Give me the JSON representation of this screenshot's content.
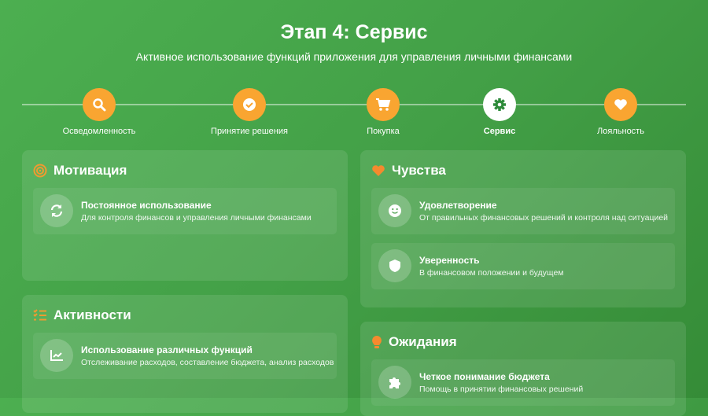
{
  "header": {
    "title": "Этап 4: Сервис",
    "subtitle": "Активное использование функций приложения для управления личными финансами"
  },
  "steps": [
    {
      "label": "Осведомленность",
      "icon": "search-icon"
    },
    {
      "label": "Принятие решения",
      "icon": "check-circle-icon"
    },
    {
      "label": "Покупка",
      "icon": "cart-icon"
    },
    {
      "label": "Сервис",
      "icon": "gear-icon",
      "active": true
    },
    {
      "label": "Лояльность",
      "icon": "heart-icon"
    }
  ],
  "cards": {
    "motivation": {
      "title": "Мотивация",
      "icon": "target-icon",
      "items": [
        {
          "title": "Постоянное использование",
          "desc": "Для контроля финансов и управления личными финансами",
          "icon": "sync-icon"
        }
      ]
    },
    "activities": {
      "title": "Активности",
      "icon": "task-list-icon",
      "items": [
        {
          "title": "Использование различных функций",
          "desc": "Отслеживание расходов, составление бюджета, анализ расходов",
          "icon": "chart-line-icon"
        }
      ]
    },
    "feelings": {
      "title": "Чувства",
      "icon": "heart-icon",
      "items": [
        {
          "title": "Удовлетворение",
          "desc": "От правильных финансовых решений и контроля над ситуацией",
          "icon": "smile-icon"
        },
        {
          "title": "Уверенность",
          "desc": "В финансовом положении и будущем",
          "icon": "shield-icon"
        }
      ]
    },
    "expectations": {
      "title": "Ожидания",
      "icon": "lightbulb-icon",
      "items": [
        {
          "title": "Четкое понимание бюджета",
          "desc": "Помощь в принятии финансовых решений",
          "icon": "puzzle-icon"
        }
      ]
    }
  },
  "colors": {
    "accent": "#f9a531",
    "active_icon": "#2e8b3a"
  }
}
